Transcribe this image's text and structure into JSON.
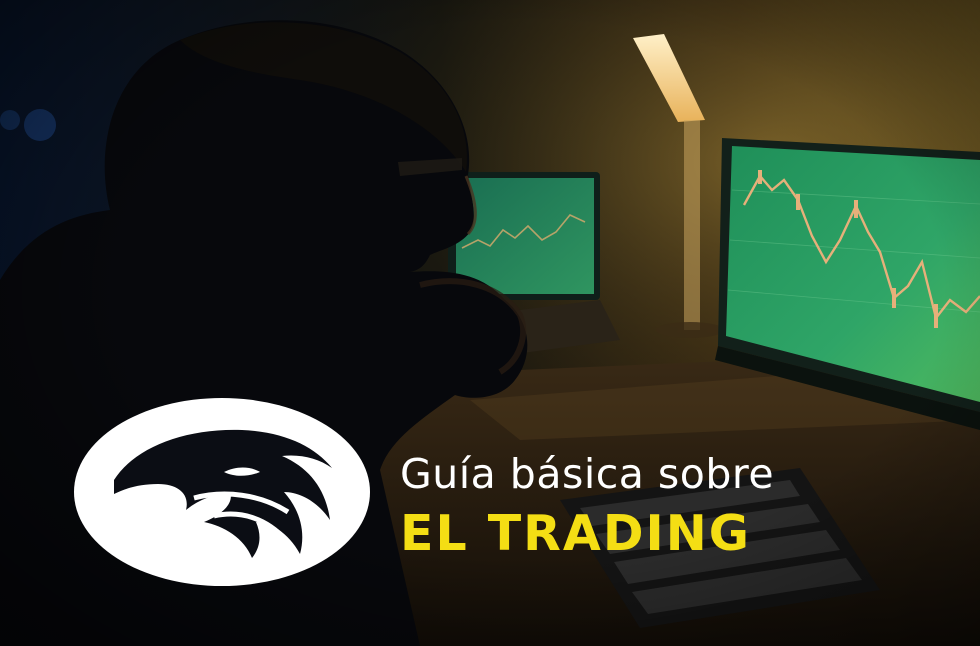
{
  "headline": {
    "line1": "Guía básica sobre",
    "line2": "EL TRADING"
  },
  "logo": {
    "icon": "eagle-head-icon"
  },
  "colors": {
    "accent_yellow": "#f4de14",
    "text_white": "#ffffff",
    "monitor_green": "#2fa567",
    "background_dark": "#0a0c12"
  }
}
